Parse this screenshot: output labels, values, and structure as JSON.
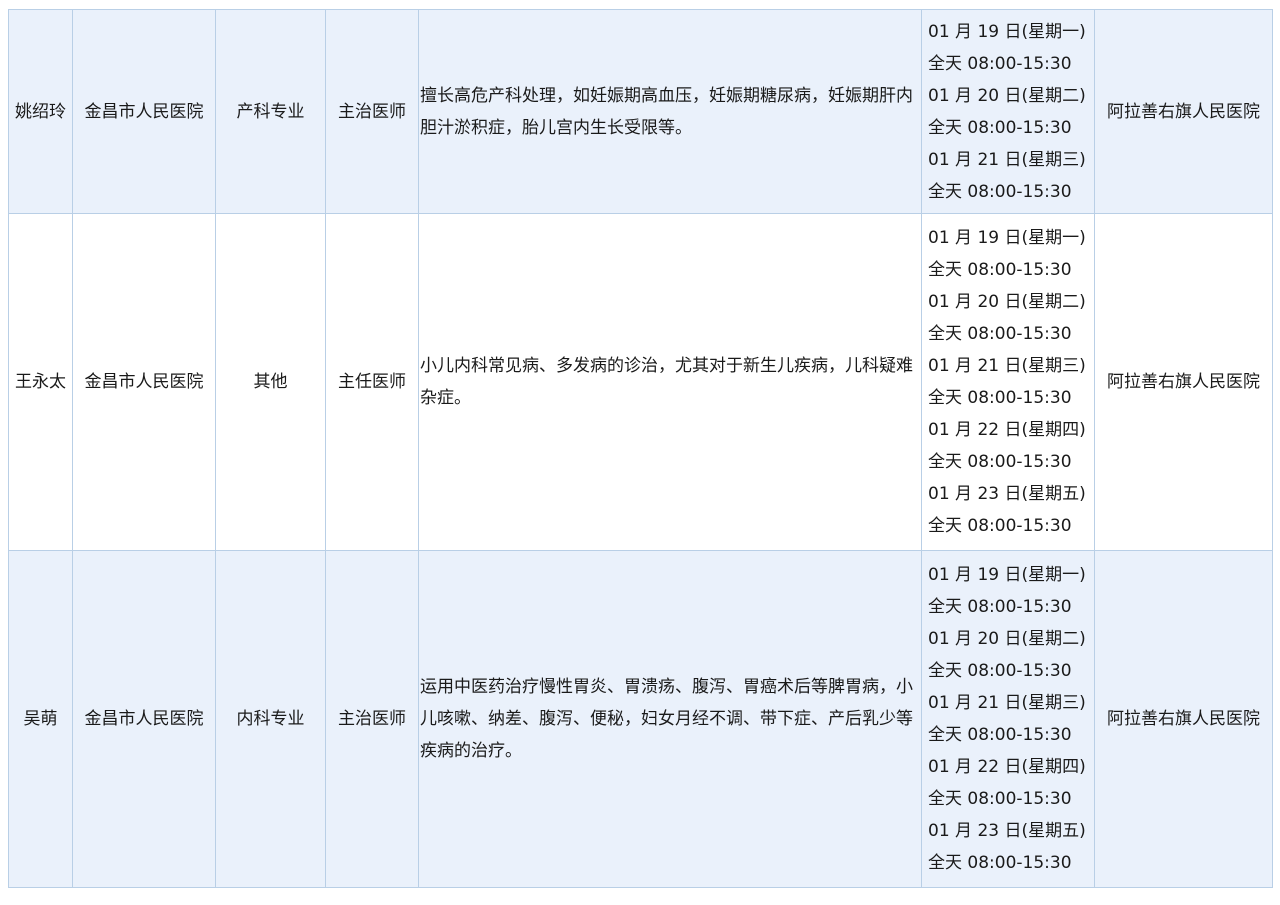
{
  "rows": [
    {
      "name": "姚绍玲",
      "hospital": "金昌市人民医院",
      "specialty": "产科专业",
      "title": "主治医师",
      "description": "擅长高危产科处理，如妊娠期高血压，妊娠期糖尿病，妊娠期肝内胆汁淤积症，胎儿宫内生长受限等。",
      "schedule": [
        "01 月 19 日(星期一)",
        "全天 08:00-15:30",
        "01 月 20 日(星期二)",
        "全天 08:00-15:30",
        "01 月 21 日(星期三)",
        "全天 08:00-15:30"
      ],
      "destination": "阿拉善右旗人民医院"
    },
    {
      "name": "王永太",
      "hospital": "金昌市人民医院",
      "specialty": "其他",
      "title": "主任医师",
      "description": "小儿内科常见病、多发病的诊治，尤其对于新生儿疾病，儿科疑难杂症。",
      "schedule": [
        "01 月 19 日(星期一)",
        "全天 08:00-15:30",
        "01 月 20 日(星期二)",
        "全天 08:00-15:30",
        "01 月 21 日(星期三)",
        "全天 08:00-15:30",
        "01 月 22 日(星期四)",
        "全天 08:00-15:30",
        "01 月 23 日(星期五)",
        "全天 08:00-15:30"
      ],
      "destination": "阿拉善右旗人民医院"
    },
    {
      "name": "吴萌",
      "hospital": "金昌市人民医院",
      "specialty": "内科专业",
      "title": "主治医师",
      "description": "运用中医药治疗慢性胃炎、胃溃疡、腹泻、胃癌术后等脾胃病，小儿咳嗽、纳差、腹泻、便秘，妇女月经不调、带下症、产后乳少等疾病的治疗。",
      "schedule": [
        "01 月 19 日(星期一)",
        "全天 08:00-15:30",
        "01 月 20 日(星期二)",
        "全天 08:00-15:30",
        "01 月 21 日(星期三)",
        "全天 08:00-15:30",
        "01 月 22 日(星期四)",
        "全天 08:00-15:30",
        "01 月 23 日(星期五)",
        "全天 08:00-15:30"
      ],
      "destination": "阿拉善右旗人民医院"
    }
  ]
}
